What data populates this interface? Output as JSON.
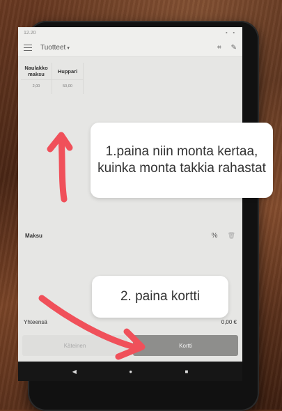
{
  "status_bar": {
    "time": "12.20",
    "system_icons": "▪ ▪"
  },
  "app_bar": {
    "menu_icon": "hamburger-menu-icon",
    "title": "Tuotteet",
    "dropdown_icon": "▾",
    "scan_icon": "⌗",
    "edit_icon": "✎"
  },
  "products": [
    {
      "name": "Naulakko maksu",
      "price": "2,00"
    },
    {
      "name": "Huppari",
      "price": "50,00"
    }
  ],
  "payment_row": {
    "label": "Maksu",
    "discount_icon": "%",
    "trash_icon": "🗑"
  },
  "total": {
    "label": "Yhteensä",
    "value": "0,00 €"
  },
  "buttons": {
    "cash": "Käteinen",
    "card": "Kortti"
  },
  "nav": {
    "back": "◀",
    "home": "●",
    "recents": "■"
  },
  "annotations": {
    "step1": "1.paina niin monta kertaa, kuinka monta takkia rahastat",
    "step2": "2. paina kortti"
  },
  "colors": {
    "arrow": "#f0505a",
    "card_button": "#8e8e8c"
  }
}
